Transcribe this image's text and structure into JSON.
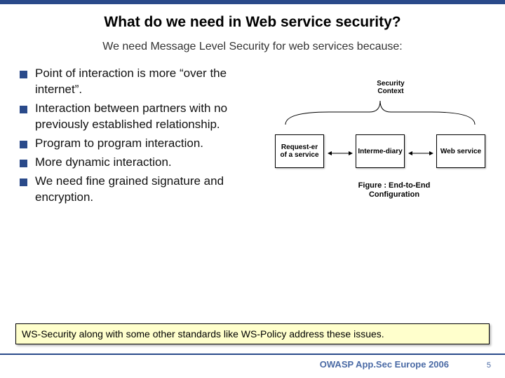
{
  "title": "What do we need in Web service security?",
  "subtitle": "We need Message Level Security for web services because:",
  "bullets": [
    "Point of interaction is more “over the internet”.",
    "Interaction between partners with no previously established relationship.",
    "Program to program interaction.",
    "More dynamic interaction.",
    "We need fine grained signature and encryption."
  ],
  "diagram": {
    "context_label": "Security Context",
    "box1": "Request-er of a service",
    "box2": "Interme-diary",
    "box3": "Web service",
    "caption": "Figure : End-to-End Configuration"
  },
  "callout": "WS-Security along with some other standards like WS-Policy address these issues.",
  "footer": "OWASP App.Sec Europe 2006",
  "page": "5"
}
